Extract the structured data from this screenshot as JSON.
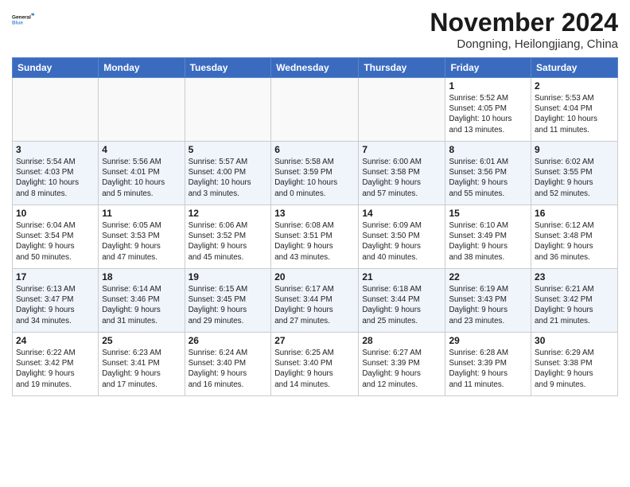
{
  "logo": {
    "line1": "General",
    "line2": "Blue"
  },
  "title": "November 2024",
  "location": "Dongning, Heilongjiang, China",
  "days_of_week": [
    "Sunday",
    "Monday",
    "Tuesday",
    "Wednesday",
    "Thursday",
    "Friday",
    "Saturday"
  ],
  "weeks": [
    [
      {
        "day": "",
        "info": ""
      },
      {
        "day": "",
        "info": ""
      },
      {
        "day": "",
        "info": ""
      },
      {
        "day": "",
        "info": ""
      },
      {
        "day": "",
        "info": ""
      },
      {
        "day": "1",
        "info": "Sunrise: 5:52 AM\nSunset: 4:05 PM\nDaylight: 10 hours\nand 13 minutes."
      },
      {
        "day": "2",
        "info": "Sunrise: 5:53 AM\nSunset: 4:04 PM\nDaylight: 10 hours\nand 11 minutes."
      }
    ],
    [
      {
        "day": "3",
        "info": "Sunrise: 5:54 AM\nSunset: 4:03 PM\nDaylight: 10 hours\nand 8 minutes."
      },
      {
        "day": "4",
        "info": "Sunrise: 5:56 AM\nSunset: 4:01 PM\nDaylight: 10 hours\nand 5 minutes."
      },
      {
        "day": "5",
        "info": "Sunrise: 5:57 AM\nSunset: 4:00 PM\nDaylight: 10 hours\nand 3 minutes."
      },
      {
        "day": "6",
        "info": "Sunrise: 5:58 AM\nSunset: 3:59 PM\nDaylight: 10 hours\nand 0 minutes."
      },
      {
        "day": "7",
        "info": "Sunrise: 6:00 AM\nSunset: 3:58 PM\nDaylight: 9 hours\nand 57 minutes."
      },
      {
        "day": "8",
        "info": "Sunrise: 6:01 AM\nSunset: 3:56 PM\nDaylight: 9 hours\nand 55 minutes."
      },
      {
        "day": "9",
        "info": "Sunrise: 6:02 AM\nSunset: 3:55 PM\nDaylight: 9 hours\nand 52 minutes."
      }
    ],
    [
      {
        "day": "10",
        "info": "Sunrise: 6:04 AM\nSunset: 3:54 PM\nDaylight: 9 hours\nand 50 minutes."
      },
      {
        "day": "11",
        "info": "Sunrise: 6:05 AM\nSunset: 3:53 PM\nDaylight: 9 hours\nand 47 minutes."
      },
      {
        "day": "12",
        "info": "Sunrise: 6:06 AM\nSunset: 3:52 PM\nDaylight: 9 hours\nand 45 minutes."
      },
      {
        "day": "13",
        "info": "Sunrise: 6:08 AM\nSunset: 3:51 PM\nDaylight: 9 hours\nand 43 minutes."
      },
      {
        "day": "14",
        "info": "Sunrise: 6:09 AM\nSunset: 3:50 PM\nDaylight: 9 hours\nand 40 minutes."
      },
      {
        "day": "15",
        "info": "Sunrise: 6:10 AM\nSunset: 3:49 PM\nDaylight: 9 hours\nand 38 minutes."
      },
      {
        "day": "16",
        "info": "Sunrise: 6:12 AM\nSunset: 3:48 PM\nDaylight: 9 hours\nand 36 minutes."
      }
    ],
    [
      {
        "day": "17",
        "info": "Sunrise: 6:13 AM\nSunset: 3:47 PM\nDaylight: 9 hours\nand 34 minutes."
      },
      {
        "day": "18",
        "info": "Sunrise: 6:14 AM\nSunset: 3:46 PM\nDaylight: 9 hours\nand 31 minutes."
      },
      {
        "day": "19",
        "info": "Sunrise: 6:15 AM\nSunset: 3:45 PM\nDaylight: 9 hours\nand 29 minutes."
      },
      {
        "day": "20",
        "info": "Sunrise: 6:17 AM\nSunset: 3:44 PM\nDaylight: 9 hours\nand 27 minutes."
      },
      {
        "day": "21",
        "info": "Sunrise: 6:18 AM\nSunset: 3:44 PM\nDaylight: 9 hours\nand 25 minutes."
      },
      {
        "day": "22",
        "info": "Sunrise: 6:19 AM\nSunset: 3:43 PM\nDaylight: 9 hours\nand 23 minutes."
      },
      {
        "day": "23",
        "info": "Sunrise: 6:21 AM\nSunset: 3:42 PM\nDaylight: 9 hours\nand 21 minutes."
      }
    ],
    [
      {
        "day": "24",
        "info": "Sunrise: 6:22 AM\nSunset: 3:42 PM\nDaylight: 9 hours\nand 19 minutes."
      },
      {
        "day": "25",
        "info": "Sunrise: 6:23 AM\nSunset: 3:41 PM\nDaylight: 9 hours\nand 17 minutes."
      },
      {
        "day": "26",
        "info": "Sunrise: 6:24 AM\nSunset: 3:40 PM\nDaylight: 9 hours\nand 16 minutes."
      },
      {
        "day": "27",
        "info": "Sunrise: 6:25 AM\nSunset: 3:40 PM\nDaylight: 9 hours\nand 14 minutes."
      },
      {
        "day": "28",
        "info": "Sunrise: 6:27 AM\nSunset: 3:39 PM\nDaylight: 9 hours\nand 12 minutes."
      },
      {
        "day": "29",
        "info": "Sunrise: 6:28 AM\nSunset: 3:39 PM\nDaylight: 9 hours\nand 11 minutes."
      },
      {
        "day": "30",
        "info": "Sunrise: 6:29 AM\nSunset: 3:38 PM\nDaylight: 9 hours\nand 9 minutes."
      }
    ]
  ]
}
